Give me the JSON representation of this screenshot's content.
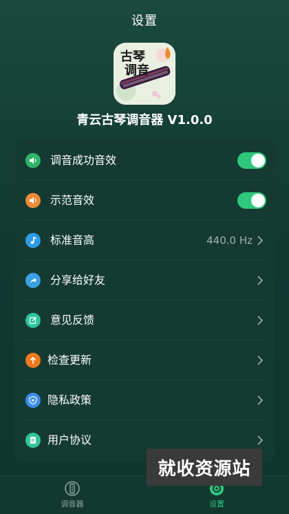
{
  "header": {
    "title": "设置"
  },
  "app": {
    "icon_name": "guqin-app-icon",
    "icon_text_line1": "古琴",
    "icon_text_line2": "调音",
    "name": "青云古琴调音器 V1.0.0"
  },
  "settings": {
    "items": [
      {
        "label": "调音成功音效",
        "icon": "speaker-icon",
        "icon_color": "#2fb36a",
        "control": "toggle",
        "checked": true
      },
      {
        "label": "示范音效",
        "icon": "speaker-icon",
        "icon_color": "#ef8b3a",
        "control": "toggle",
        "checked": true
      },
      {
        "label": "标准音高",
        "icon": "music-note-icon",
        "icon_color": "#2f9be8",
        "control": "value",
        "value": "440.0 Hz"
      },
      {
        "label": "分享给好友",
        "icon": "share-icon",
        "icon_color": "#3aa0e6",
        "control": "chevron"
      },
      {
        "label": "意见反馈",
        "icon": "edit-icon",
        "icon_color": "#2ec59a",
        "control": "chevron"
      },
      {
        "label": "检查更新",
        "icon": "arrow-up-icon",
        "icon_color": "#f07a1e",
        "control": "chevron"
      },
      {
        "label": "隐私政策",
        "icon": "shield-icon",
        "icon_color": "#3d8ee8",
        "control": "chevron"
      },
      {
        "label": "用户协议",
        "icon": "document-icon",
        "icon_color": "#33c79a",
        "control": "chevron"
      }
    ]
  },
  "tabbar": {
    "tabs": [
      {
        "label": "调音器",
        "icon": "tuner-icon",
        "active": false
      },
      {
        "label": "设置",
        "icon": "gear-icon",
        "active": true
      }
    ]
  },
  "watermark": {
    "text": "就收资源站"
  },
  "colors": {
    "accent": "#2ec77c",
    "background": "#123a31",
    "card": "#143a31"
  }
}
